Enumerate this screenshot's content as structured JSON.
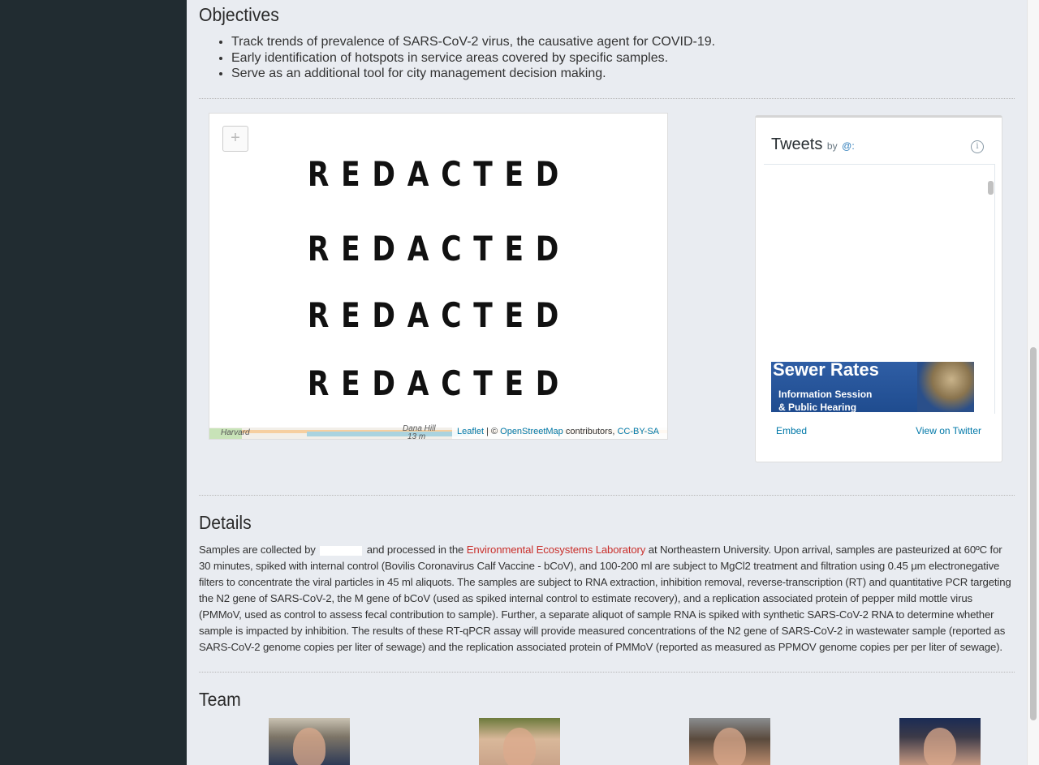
{
  "objectives": {
    "title": "Objectives",
    "items": [
      "Track trends of prevalence of SARS-CoV-2 virus, the causative agent for COVID-19.",
      "Early identification of hotspots in service areas covered by specific samples.",
      "Serve as an additional tool for city management decision making."
    ]
  },
  "map": {
    "zoom_in_label": "+",
    "redacted_label": "REDACTED",
    "attribution": {
      "leaflet": "Leaflet",
      "separator": " | © ",
      "osm": "OpenStreetMap",
      "contributors": " contributors, ",
      "license": "CC-BY-SA"
    },
    "place_labels": [
      "Harvard",
      "Dana Hill",
      "13 m"
    ]
  },
  "tweets": {
    "title": "Tweets",
    "by": "by",
    "handle": "@:",
    "info_icon": "i",
    "image_heading": "Sewer Rates",
    "image_line1": "Information Session",
    "image_line2": "& Public Hearing",
    "embed_label": "Embed",
    "view_label": "View on Twitter"
  },
  "details": {
    "title": "Details",
    "text_before_blank": "Samples are collected by",
    "text_after_blank": "and processed in the",
    "lab_link": "Environmental Ecosystems Laboratory",
    "text_rest": "at Northeastern University. Upon arrival, samples are pasteurized at 60ºC for 30 minutes, spiked with internal control (Bovilis Coronavirus Calf Vaccine - bCoV), and 100-200 ml are subject to MgCl2 treatment and filtration using 0.45 μm electronegative filters to concentrate the viral particles in 45 ml aliquots. The samples are subject to RNA extraction, inhibition removal, reverse-transcription (RT) and quantitative PCR targeting the N2 gene of SARS-CoV-2, the M gene of bCoV (used as spiked internal control to estimate recovery), and a replication associated protein of pepper mild mottle virus (PMMoV, used as control to assess fecal contribution to sample). Further, a separate aliquot of sample RNA is spiked with synthetic SARS-CoV-2 RNA to determine whether sample is impacted by inhibition. The results of these RT-qPCR assay will provide measured concentrations of the N2 gene of SARS-CoV-2 in wastewater sample (reported as SARS-CoV-2 genome copies per liter of sewage) and the replication associated protein of PMMoV (reported as measured as PPMOV genome copies per per liter of sewage)."
  },
  "team": {
    "title": "Team"
  }
}
